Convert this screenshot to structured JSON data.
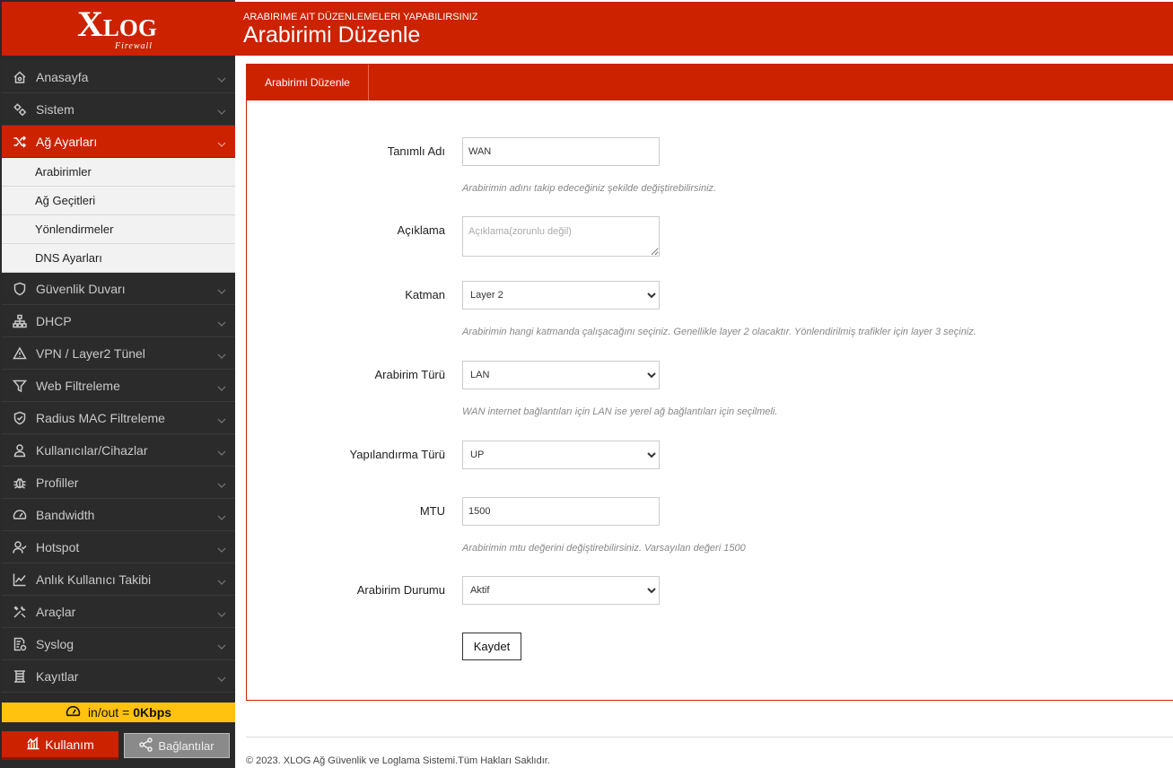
{
  "logo": {
    "main_x": "X",
    "main_rest": "LOG",
    "sub": "Firewall"
  },
  "header": {
    "subtitle": "ARABIRIME AIT DÜZENLEMELERI YAPABILIRSINIZ",
    "title": "Arabirimi Düzenle"
  },
  "colors": {
    "accent": "#cc2200",
    "sidebar_bg": "#2b2b2b",
    "speed_bar": "#ffc20e"
  },
  "sidebar": {
    "items_top": [
      {
        "label": "Anasayfa",
        "icon": "home-icon"
      },
      {
        "label": "Sistem",
        "icon": "gears-icon"
      },
      {
        "label": "Ağ Ayarları",
        "icon": "shuffle-icon"
      }
    ],
    "subitems": [
      {
        "label": "Arabirimler"
      },
      {
        "label": "Ağ Geçitleri"
      },
      {
        "label": "Yönlendirmeler"
      },
      {
        "label": "DNS Ayarları"
      }
    ],
    "items_bottom": [
      {
        "label": "Güvenlik Duvarı",
        "icon": "shield-icon"
      },
      {
        "label": "DHCP",
        "icon": "sitemap-icon"
      },
      {
        "label": "VPN / Layer2 Tünel",
        "icon": "warning-icon"
      },
      {
        "label": "Web Filtreleme",
        "icon": "filter-icon"
      },
      {
        "label": "Radius MAC Filtreleme",
        "icon": "shield-check-icon"
      },
      {
        "label": "Kullanıcılar/Cihazlar",
        "icon": "user-icon"
      },
      {
        "label": "Profiller",
        "icon": "bug-icon"
      },
      {
        "label": "Bandwidth",
        "icon": "gauge-icon"
      },
      {
        "label": "Hotspot",
        "icon": "user-check-icon"
      },
      {
        "label": "Anlık Kullanıcı Takibi",
        "icon": "line-chart-icon"
      },
      {
        "label": "Araçlar",
        "icon": "tools-icon"
      },
      {
        "label": "Syslog",
        "icon": "file-gear-icon"
      },
      {
        "label": "Kayıtlar",
        "icon": "logs-icon"
      }
    ],
    "speed": {
      "prefix": "in/out =",
      "value": "0Kbps"
    },
    "usage_button": "Kullanım",
    "connections_button": "Bağlantılar"
  },
  "panel": {
    "tab": "Arabirimi Düzenle",
    "fields": {
      "name": {
        "label": "Tanımlı Adı",
        "value": "WAN",
        "help": "Arabirimin adını takip edeceğiniz şekilde değiştirebilirsiniz."
      },
      "description": {
        "label": "Açıklama",
        "placeholder": "Açıklama(zorunlu değil)"
      },
      "layer": {
        "label": "Katman",
        "value": "Layer 2",
        "help": "Arabirimin hangi katmanda çalışacağını seçiniz. Genellikle layer 2 olacaktır. Yönlendirilmiş trafikler için layer 3 seçiniz."
      },
      "type": {
        "label": "Arabirim Türü",
        "value": "LAN",
        "help": "WAN internet bağlantıları için LAN ise yerel ağ bağlantıları için seçilmeli."
      },
      "config": {
        "label": "Yapılandırma Türü",
        "value": "UP"
      },
      "mtu": {
        "label": "MTU",
        "value": "1500",
        "help": "Arabirimin mtu değerini değiştirebilirsiniz. Varsayılan değeri 1500"
      },
      "status": {
        "label": "Arabirim Durumu",
        "value": "Aktif"
      }
    },
    "save_button": "Kaydet"
  },
  "footer": {
    "text": "© 2023. XLOG Ağ Güvenlik ve Loglama Sistemi.Tüm Hakları Saklıdır."
  }
}
